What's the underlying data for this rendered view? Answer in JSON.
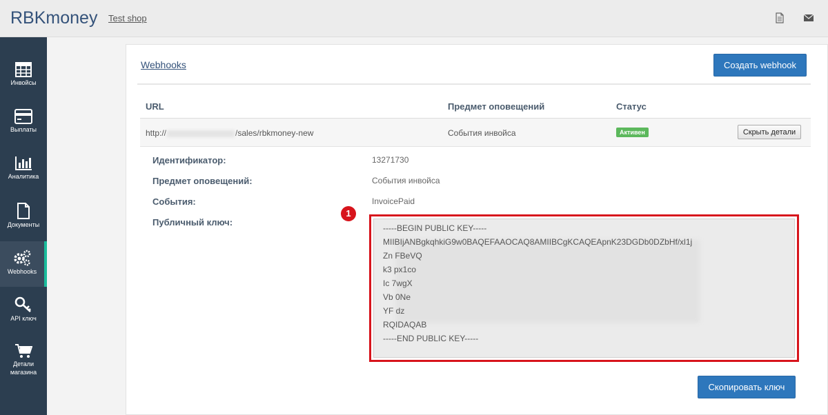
{
  "header": {
    "brand": "RBKmoney",
    "shop_link": "Test shop",
    "icons": [
      "document-icon",
      "mail-icon"
    ]
  },
  "sidebar": {
    "items": [
      {
        "label": "Инвойсы",
        "icon": "grid-icon",
        "active": false
      },
      {
        "label": "Выплаты",
        "icon": "credit-card-icon",
        "active": false
      },
      {
        "label": "Аналитика",
        "icon": "bar-chart-icon",
        "active": false
      },
      {
        "label": "Документы",
        "icon": "file-icon",
        "active": false
      },
      {
        "label": "Webhooks",
        "icon": "gears-icon",
        "active": true
      },
      {
        "label": "API ключ",
        "icon": "key-icon",
        "active": false
      },
      {
        "label": "Детали магазина",
        "icon": "cart-icon",
        "active": false
      }
    ]
  },
  "main": {
    "title": "Webhooks",
    "create_button": "Создать webhook",
    "table": {
      "headers": [
        "URL",
        "Предмет оповещений",
        "Статус"
      ],
      "row": {
        "url_prefix": "http://",
        "url_suffix": "/sales/rbkmoney-new",
        "subject": "События инвойса",
        "status": "Активен",
        "hide_button": "Скрыть детали"
      }
    },
    "details": [
      {
        "label": "Идентификатор:",
        "value": "13271730"
      },
      {
        "label": "Предмет оповещений:",
        "value": "События инвойса"
      },
      {
        "label": "События:",
        "value": "InvoicePaid"
      },
      {
        "label": "Публичный ключ:",
        "value": ""
      }
    ],
    "marker": "1",
    "public_key": {
      "lines": [
        "-----BEGIN PUBLIC KEY-----",
        "MIIBIjANBgkqhkiG9w0BAQEFAAOCAQ8AMIIBCgKCAQEApnK23DGDb0DZbHf/xl1j",
        "Zn                                                                                                          FBeVQ",
        "k3                                                                                                          px1co",
        "Ic                                                                                                          7wgX",
        "Vb                                                                                                          0Ne",
        "YF                                                                                                         dz",
        "RQIDAQAB",
        "-----END PUBLIC KEY-----"
      ]
    },
    "copy_button": "Скопировать ключ"
  },
  "colors": {
    "sidebar_bg": "#2c3e50",
    "accent": "#1abc9c",
    "primary_button": "#2e77bc",
    "status_active": "#5cb85c",
    "highlight": "#d7141c"
  }
}
